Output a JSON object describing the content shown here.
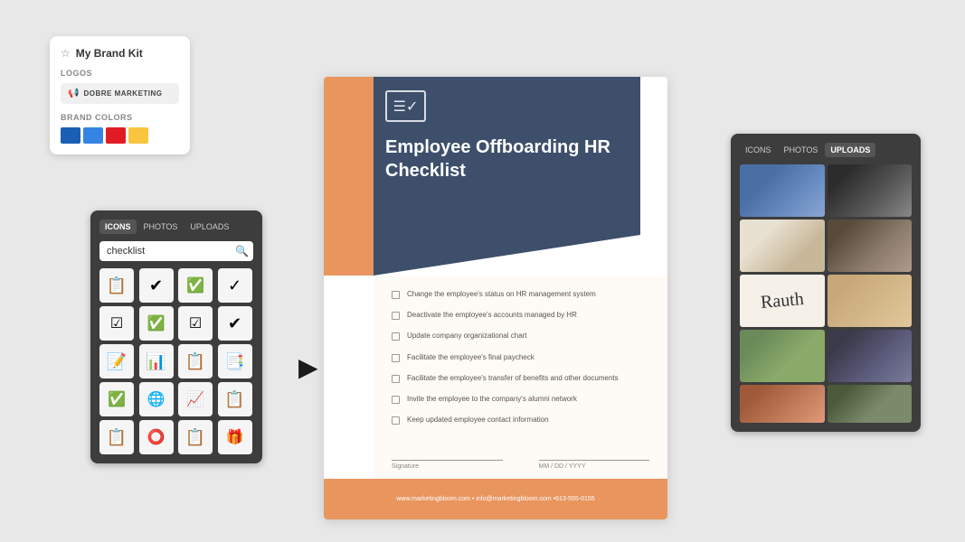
{
  "brand_kit": {
    "title": "My Brand Kit",
    "logos_label": "LOGOS",
    "logo_name": "DOBRE MARKETING",
    "brand_colors_label": "BRAND COLORS",
    "colors": [
      "#1a5fb4",
      "#3584e4",
      "#e01b24",
      "#f9c440"
    ]
  },
  "icons_panel": {
    "tabs": [
      "ICONS",
      "PHOTOS",
      "UPLOADS"
    ],
    "active_tab": "ICONS",
    "search_placeholder": "checklist",
    "icons": [
      "📋",
      "✔",
      "✅",
      "✓",
      "☑",
      "✅",
      "☑",
      "✔",
      "📝",
      "📊",
      "📋",
      "📑",
      "✅",
      "🌐",
      "📈",
      "📋",
      "📋",
      "⭕",
      "📋",
      "🎁"
    ]
  },
  "document": {
    "icon": "≡",
    "title": "Employee Offboarding HR Checklist",
    "checklist_items": [
      "Change the employee's status on HR management system",
      "Deactivate the employee's accounts managed by HR",
      "Update company organizational chart",
      "Facilitate the employee's final paycheck",
      "Facilitate the employee's transfer of benefits and other documents",
      "Invite the employee to the company's alumni network",
      "Keep updated employee contact information"
    ],
    "signature_label": "Signature",
    "date_label": "MM / DD / YYYY",
    "footer_text": "www.marketingbloom.com  •  info@marketingbloom.com  •613-555-0155"
  },
  "photos_panel": {
    "tabs": [
      "ICONS",
      "PHOTOS",
      "UPLOADS"
    ],
    "active_tab": "UPLOADS"
  }
}
